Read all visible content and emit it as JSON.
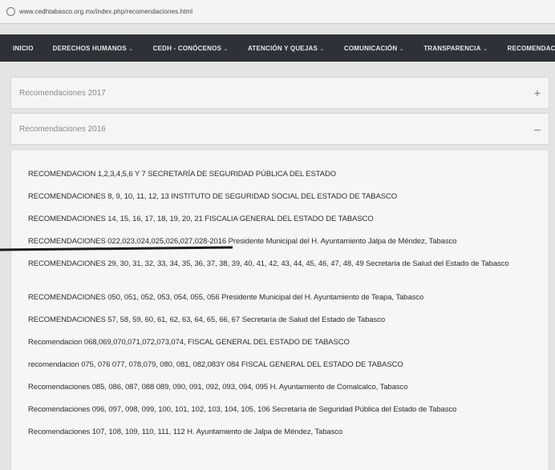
{
  "browser": {
    "url": "www.cedhtabasco.org.mx/index.php/recomendaciones.html"
  },
  "nav": {
    "items": [
      {
        "label": "INICIO",
        "caret": ""
      },
      {
        "label": "DERECHOS HUMANOS",
        "caret": "⌄"
      },
      {
        "label": "CEDH - CONÓCENOS",
        "caret": "⌄"
      },
      {
        "label": "ATENCIÓN Y QUEJAS",
        "caret": "⌄"
      },
      {
        "label": "COMUNICACIÓN",
        "caret": "⌄"
      },
      {
        "label": "TRANSPARENCIA",
        "caret": "⌄"
      },
      {
        "label": "RECOMENDACIONES",
        "caret": ""
      }
    ]
  },
  "accordion": {
    "section_2017": {
      "title": "Recomendaciones 2017",
      "toggle": "+"
    },
    "section_2016": {
      "title": "Recomendaciones 2016",
      "toggle": "–"
    }
  },
  "recommendations": [
    "RECOMENDACION 1,2,3,4,5,6 Y 7 SECRETARÍA DE SEGURIDAD PÚBLICA DEL ESTADO",
    "RECOMENDACIONES 8, 9, 10, 11, 12, 13 INSTITUTO DE SEGURIDAD SOCIAL DEL ESTADO DE TABASCO",
    "RECOMENDACIONES 14, 15, 16, 17, 18, 19, 20, 21 FISCALIA GENERAL DEL ESTADO DE TABASCO",
    "RECOMENDACIONES 022,023,024,025,026,027,028-2016 Presidente Municipal del H. Ayuntamiento Jalpa de Méndez, Tabasco",
    "RECOMENDACIONES 29, 30, 31, 32, 33, 34, 35, 36, 37, 38, 39, 40, 41, 42, 43, 44, 45, 46, 47, 48, 49 Secretaría de Salud del Estado de Tabasco",
    "RECOMENDACIONES 050, 051, 052, 053, 054, 055, 056 Presidente Municipal del H. Ayuntamiento de Teapa, Tabasco",
    "RECOMENDACIONES 57, 58, 59, 60, 61, 62, 63, 64, 65, 66, 67 Secretaría de Salud del Estado de Tabasco",
    "Recomendacion 068,069,070,071,072,073,074, FISCAL GENERAL DEL ESTADO DE TABASCO",
    "recomendacion 075, 076 077, 078,079, 080, 081, 082,083Y 084 FISCAL GENERAL DEL ESTADO DE TABASCO",
    "Recomendaciones 085, 086, 087, 088 089, 090, 091, 092, 093, 094, 095 H. Ayuntamiento de Comalcalco, Tabasco",
    "Recomendaciones 096, 097, 098, 099, 100, 101, 102, 103, 104, 105, 106 Secretaría de Seguridad Pública del Estado de Tabasco",
    "Recomendaciones 107, 108, 109, 110, 111, 112 H. Ayuntamiento de Jalpa de Méndez, Tabasco"
  ]
}
